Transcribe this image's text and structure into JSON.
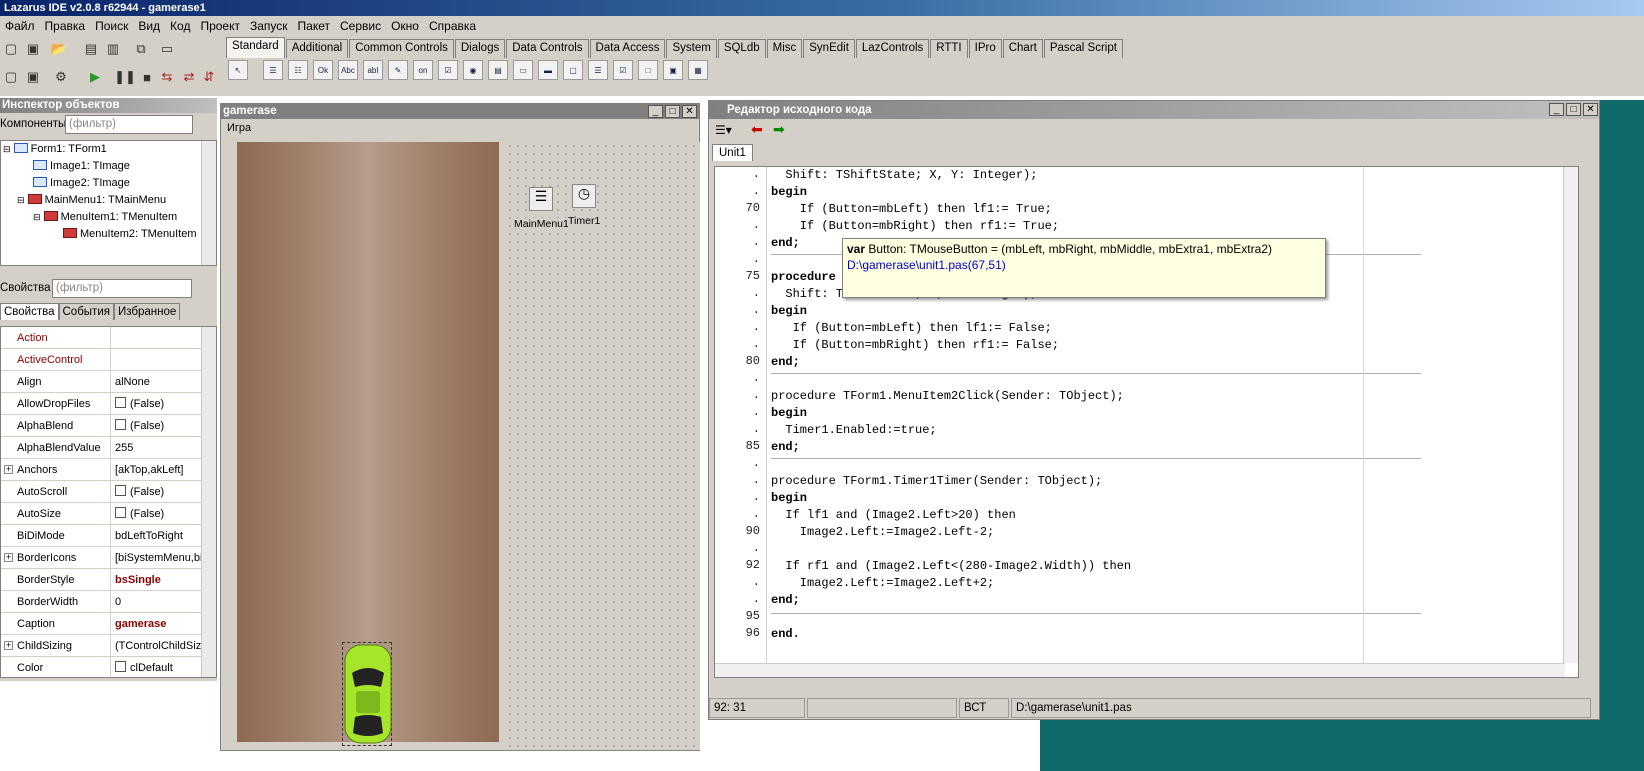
{
  "app": {
    "title": "Lazarus IDE v2.0.8 r62944 - gamerase1"
  },
  "menu": [
    "Файл",
    "Правка",
    "Поиск",
    "Вид",
    "Код",
    "Проект",
    "Запуск",
    "Пакет",
    "Сервис",
    "Окно",
    "Справка"
  ],
  "palette_tabs": [
    "Standard",
    "Additional",
    "Common Controls",
    "Dialogs",
    "Data Controls",
    "Data Access",
    "System",
    "SQLdb",
    "Misc",
    "SynEdit",
    "LazControls",
    "RTTI",
    "IPro",
    "Chart",
    "Pascal Script"
  ],
  "palette_icons": [
    "Ok",
    "Abc",
    "abI",
    "on"
  ],
  "inspector": {
    "title": "Инспектор объектов",
    "components_label": "Компоненты",
    "filter_placeholder": "(фильтр)",
    "properties_label": "Свойства",
    "tree": [
      "Form1: TForm1",
      "Image1: TImage",
      "Image2: TImage",
      "MainMenu1: TMainMenu",
      "MenuItem1: TMenuItem",
      "MenuItem2: TMenuItem"
    ],
    "tabs": [
      "Свойства",
      "События",
      "Избранное"
    ],
    "properties": [
      {
        "name": "Action",
        "value": ""
      },
      {
        "name": "ActiveControl",
        "value": ""
      },
      {
        "name": "Align",
        "value": "alNone"
      },
      {
        "name": "AllowDropFiles",
        "value": "(False)"
      },
      {
        "name": "AlphaBlend",
        "value": "(False)"
      },
      {
        "name": "AlphaBlendValue",
        "value": "255"
      },
      {
        "name": "Anchors",
        "value": "[akTop,akLeft]"
      },
      {
        "name": "AutoScroll",
        "value": "(False)"
      },
      {
        "name": "AutoSize",
        "value": "(False)"
      },
      {
        "name": "BiDiMode",
        "value": "bdLeftToRight"
      },
      {
        "name": "BorderIcons",
        "value": "[biSystemMenu,biM"
      },
      {
        "name": "BorderStyle",
        "value": "bsSingle"
      },
      {
        "name": "BorderWidth",
        "value": "0"
      },
      {
        "name": "Caption",
        "value": "gamerase"
      },
      {
        "name": "ChildSizing",
        "value": "(TControlChildSizin"
      },
      {
        "name": "Color",
        "value": "clDefault"
      }
    ]
  },
  "form": {
    "title": "gamerase",
    "menu": "Игра",
    "mainmenu_label": "MainMenu1",
    "timer_label": "Timer1"
  },
  "editor": {
    "title": "Редактор исходного кода",
    "tab": "Unit1",
    "line_numbers": [
      ".",
      ".",
      "70",
      ".",
      ".",
      ".",
      "75",
      ".",
      ".",
      ".",
      ".",
      "80",
      ".",
      ".",
      ".",
      ".",
      "85",
      ".",
      ".",
      ".",
      ".",
      "90",
      ".",
      "92",
      ".",
      ".",
      "95",
      "96"
    ],
    "code": [
      "  Shift: TShiftState; X, Y: Integer);",
      "begin",
      "    If (Button=mbLeft) then lf1:= True;",
      "    If (Button=mbRight) then rf1:= True;",
      "end;",
      "",
      "procedure",
      "  Shift: TShiftState; X, Y: Integer);",
      "begin",
      "   If (Button=mbLeft) then lf1:= False;",
      "   If (Button=mbRight) then rf1:= False;",
      "end;",
      "",
      "procedure TForm1.MenuItem2Click(Sender: TObject);",
      "begin",
      "  Timer1.Enabled:=true;",
      "end;",
      "",
      "procedure TForm1.Timer1Timer(Sender: TObject);",
      "begin",
      "  If lf1 and (Image2.Left>20) then",
      "    Image2.Left:=Image2.Left-2;",
      "",
      "  If rf1 and (Image2.Left<(280-Image2.Width)) then",
      "    Image2.Left:=Image2.Left+2;",
      "end;",
      "",
      "end."
    ],
    "hint_line1_kw": "var",
    "hint_line1": " Button: TMouseButton = (mbLeft, mbRight, mbMiddle, mbExtra1, mbExtra2)",
    "hint_line2": "D:\\gamerase\\unit1.pas(67,51)",
    "status_pos": "92: 31",
    "status_mode": "ВСТ",
    "status_file": "D:\\gamerase\\unit1.pas"
  },
  "colors": {
    "titlebar": "#0a246a",
    "panel": "#d4d0c8",
    "teal": "#116a6a",
    "car": "#a6e52a"
  }
}
